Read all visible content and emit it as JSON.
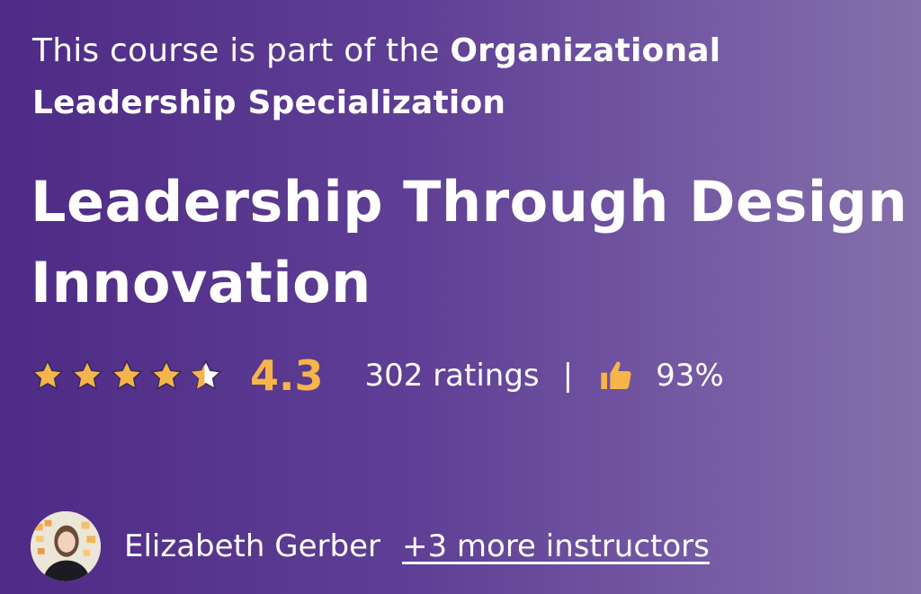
{
  "specialization": {
    "prefix": "This course is part of the ",
    "name": "Organizational Leadership Specialization"
  },
  "course": {
    "title": "Leadership Through Design Innovation"
  },
  "rating": {
    "stars_filled_fraction": 0.86,
    "value": "4.3",
    "count_text": "302 ratings",
    "separator": "|",
    "thumbs_up_percent": "93%"
  },
  "instructors": {
    "primary_name": "Elizabeth Gerber",
    "more_link": "+3 more instructors"
  },
  "colors": {
    "background_start": "#4e2b86",
    "background_end": "#8470ab",
    "star_fill": "#f5b54a",
    "rating_value": "#f5b54a",
    "thumb": "#f5b54a",
    "text": "#ffffff"
  },
  "icons": [
    "star-icon",
    "half-star-icon",
    "thumbs-up-icon",
    "instructor-avatar"
  ]
}
